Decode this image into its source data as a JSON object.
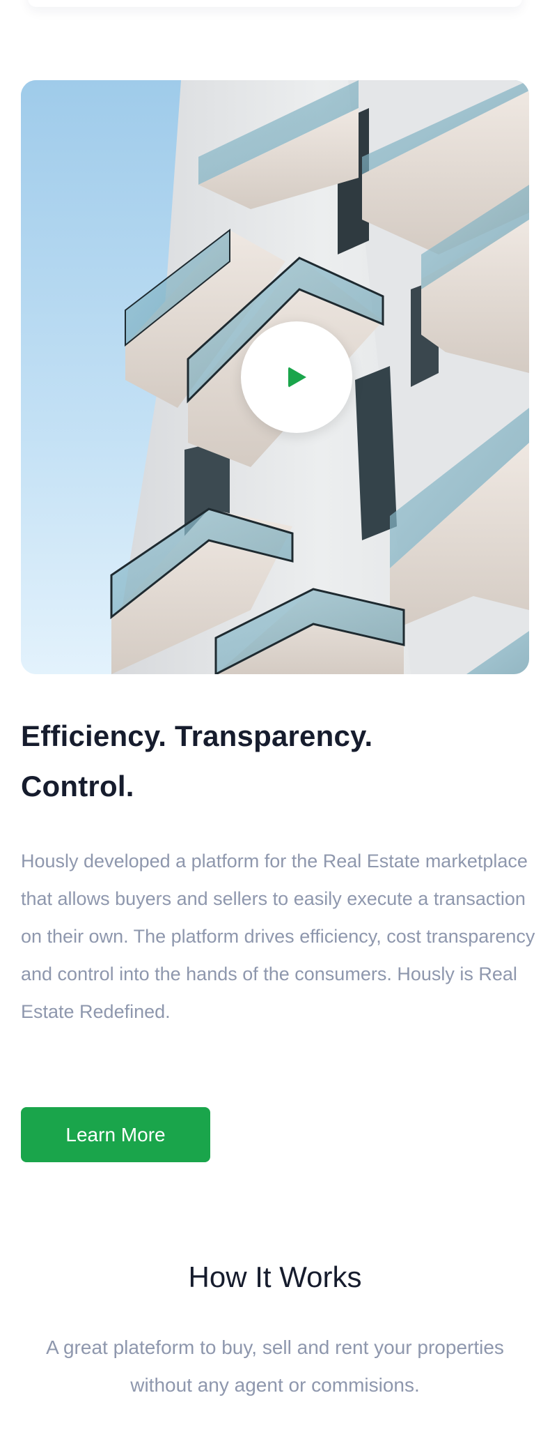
{
  "hero": {
    "image": "modern apartment building with glass balconies against blue sky",
    "play_icon": "play-icon"
  },
  "about": {
    "headline_line1": "Efficiency. Transparency.",
    "headline_line2": "Control.",
    "description": "Hously developed a platform for the Real Estate marketplace that allows buyers and sellers to easily execute a transaction on their own. The platform drives efficiency, cost transparency and control into the hands of the consumers. Hously is Real Estate Redefined.",
    "cta_label": "Learn More"
  },
  "how_it_works": {
    "title": "How It Works",
    "subtitle": "A great plateform to buy, sell and rent your properties without any agent or commisions."
  },
  "colors": {
    "accent": "#1aa54b",
    "heading": "#161c2d",
    "muted_text": "#8e97ad",
    "background": "#ffffff"
  }
}
